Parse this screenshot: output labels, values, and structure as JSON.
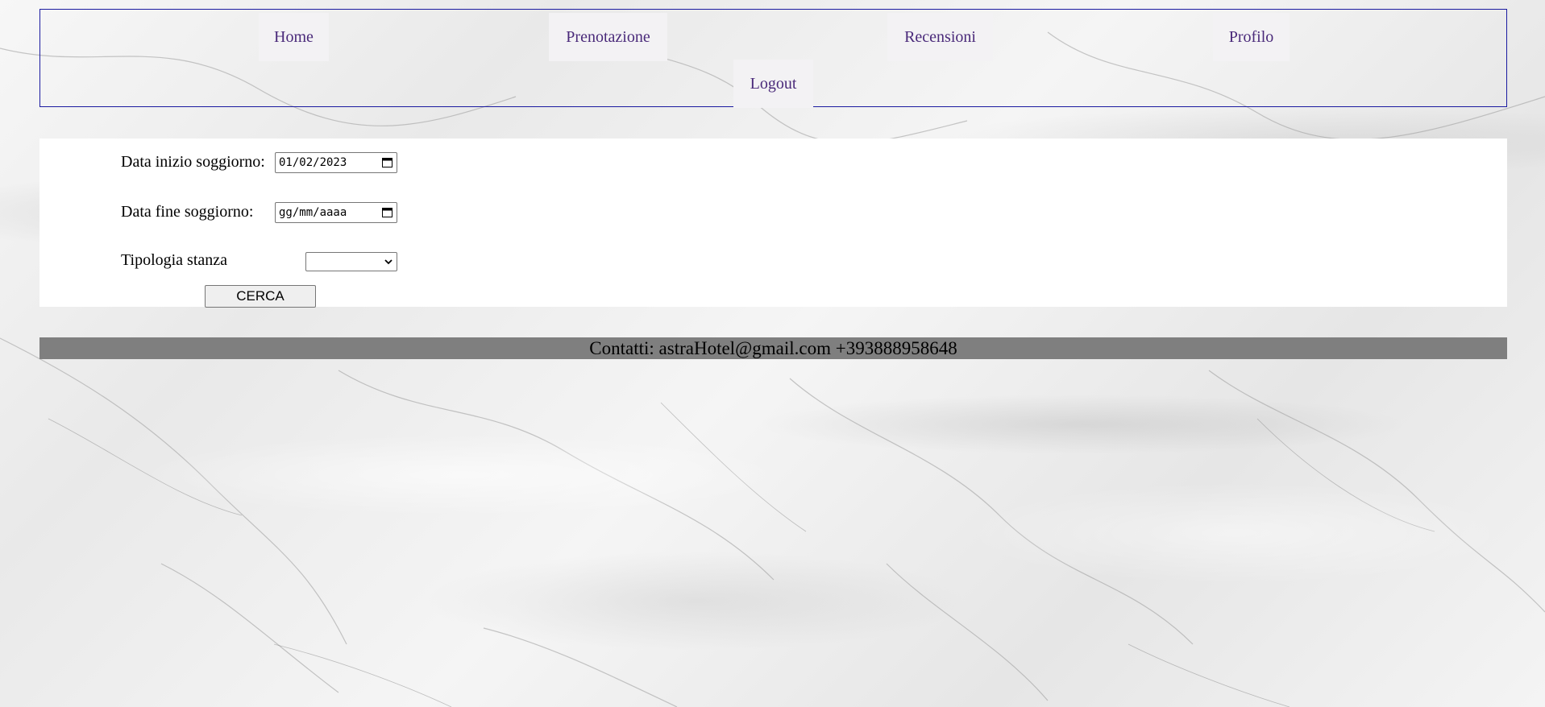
{
  "nav": {
    "items": [
      {
        "label": "Home"
      },
      {
        "label": "Prenotazione"
      },
      {
        "label": "Recensioni"
      },
      {
        "label": "Profilo"
      },
      {
        "label": "Logout"
      }
    ]
  },
  "form": {
    "start_label": "Data inizio soggiorno:",
    "start_value": "01/02/2023",
    "end_label": "Data fine soggiorno:",
    "end_value": "gg/mm/aaaa",
    "room_type_label": "Tipologia stanza",
    "room_type_value": "",
    "search_button": "CERCA"
  },
  "footer": {
    "contacts": "Contatti: astraHotel@gmail.com +393888958648"
  },
  "colors": {
    "nav_text": "#4a2a7a",
    "nav_border": "#1a1aa0",
    "footer_bg": "#7f7f7f"
  }
}
